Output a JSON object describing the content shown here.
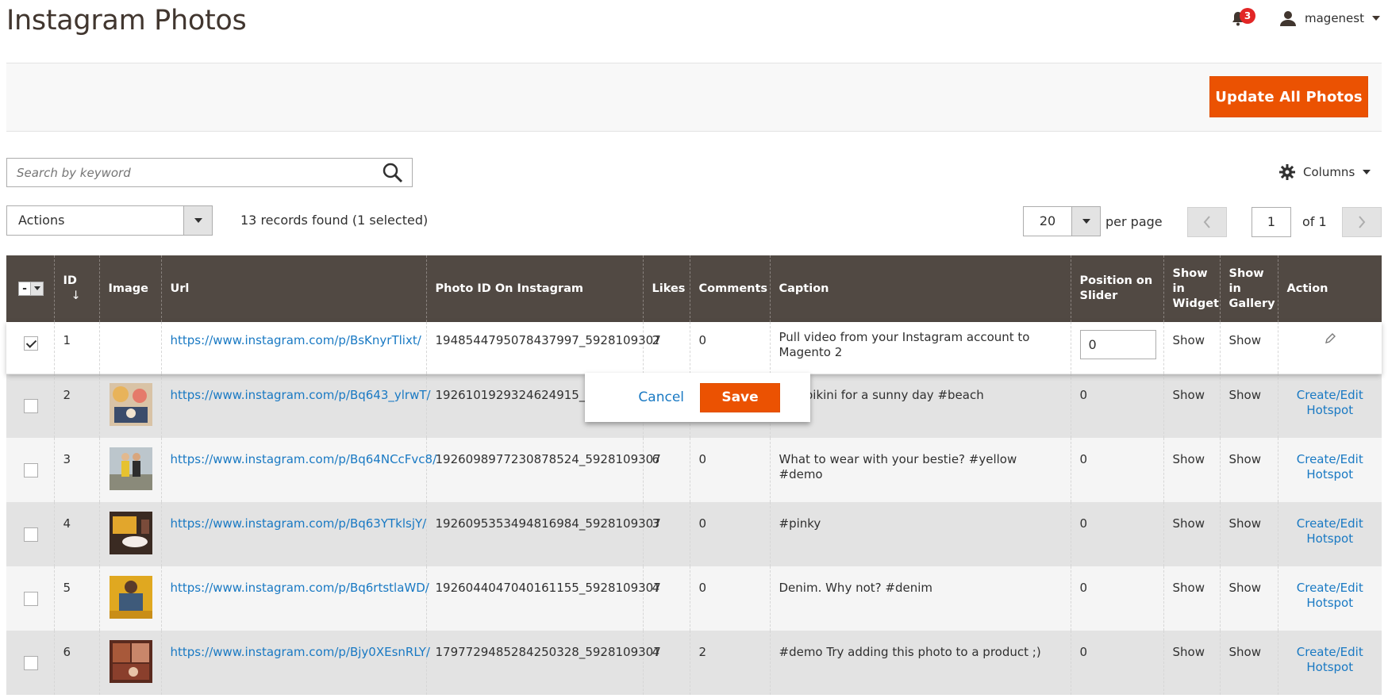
{
  "header": {
    "title": "Instagram Photos",
    "notification_count": "3",
    "username": "magenest"
  },
  "action_bar": {
    "update_all_label": "Update All Photos"
  },
  "search": {
    "placeholder": "Search by keyword"
  },
  "columns_label": "Columns",
  "mass_actions": {
    "label": "Actions"
  },
  "records_text": "13 records found (1 selected)",
  "pager": {
    "per_page_value": "20",
    "per_page_label": "per page",
    "current_page": "1",
    "of_label": "of 1"
  },
  "columns": [
    "ID",
    "Image",
    "Url",
    "Photo ID On Instagram",
    "Likes",
    "Comments",
    "Caption",
    "Position on Slider",
    "Show in Widget",
    "Show in Gallery",
    "Action"
  ],
  "rows": [
    {
      "id": "1",
      "url": "https://www.instagram.com/p/BsKnyrTlixt/",
      "photo_id": "1948544795078437997_5928109307",
      "likes": "2",
      "comments": "0",
      "caption": "Pull video from your Instagram account to Magento 2",
      "position": "0",
      "widget": "Show",
      "gallery": "Show",
      "action": "",
      "checked": true
    },
    {
      "id": "2",
      "url": "https://www.instagram.com/p/Bq643_ylrwT/",
      "photo_id": "1926101929324624915_5928109307",
      "likes": "",
      "comments": "",
      "caption": "Red bikini for a sunny day #beach",
      "position": "0",
      "widget": "Show",
      "gallery": "Show",
      "action": "Create/Edit Hotspot"
    },
    {
      "id": "3",
      "url": "https://www.instagram.com/p/Bq64NCcFvc8/",
      "photo_id": "1926098977230878524_5928109307",
      "likes": "6",
      "comments": "0",
      "caption": "What to wear with your bestie? #yellow #demo",
      "position": "0",
      "widget": "Show",
      "gallery": "Show",
      "action": "Create/Edit Hotspot"
    },
    {
      "id": "4",
      "url": "https://www.instagram.com/p/Bq63YTklsjY/",
      "photo_id": "1926095353494816984_5928109307",
      "likes": "3",
      "comments": "0",
      "caption": "#pinky",
      "position": "0",
      "widget": "Show",
      "gallery": "Show",
      "action": "Create/Edit Hotspot"
    },
    {
      "id": "5",
      "url": "https://www.instagram.com/p/Bq6rtstlaWD/",
      "photo_id": "1926044047040161155_5928109307",
      "likes": "4",
      "comments": "0",
      "caption": "Denim. Why not? #denim",
      "position": "0",
      "widget": "Show",
      "gallery": "Show",
      "action": "Create/Edit Hotspot"
    },
    {
      "id": "6",
      "url": "https://www.instagram.com/p/Bjy0XEsnRLY/",
      "photo_id": "1797729485284250328_5928109307",
      "likes": "4",
      "comments": "2",
      "caption": "#demo Try adding this photo to a product ;)",
      "position": "0",
      "widget": "Show",
      "gallery": "Show",
      "action": "Create/Edit Hotspot"
    }
  ],
  "inline_edit": {
    "cancel_label": "Cancel",
    "save_label": "Save"
  },
  "colors": {
    "accent": "#eb5202",
    "header_bg": "#514943",
    "link": "#1979c3"
  }
}
